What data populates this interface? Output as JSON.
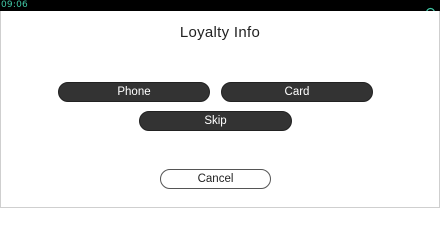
{
  "status_bar": {
    "time": "09:06",
    "icon": "cloud-icon",
    "accent_color": "#41c8a6"
  },
  "title": "Loyalty Info",
  "buttons": {
    "phone": "Phone",
    "card": "Card",
    "skip": "Skip",
    "cancel": "Cancel"
  },
  "colors": {
    "button_fill": "#333333",
    "background": "#ffffff"
  }
}
